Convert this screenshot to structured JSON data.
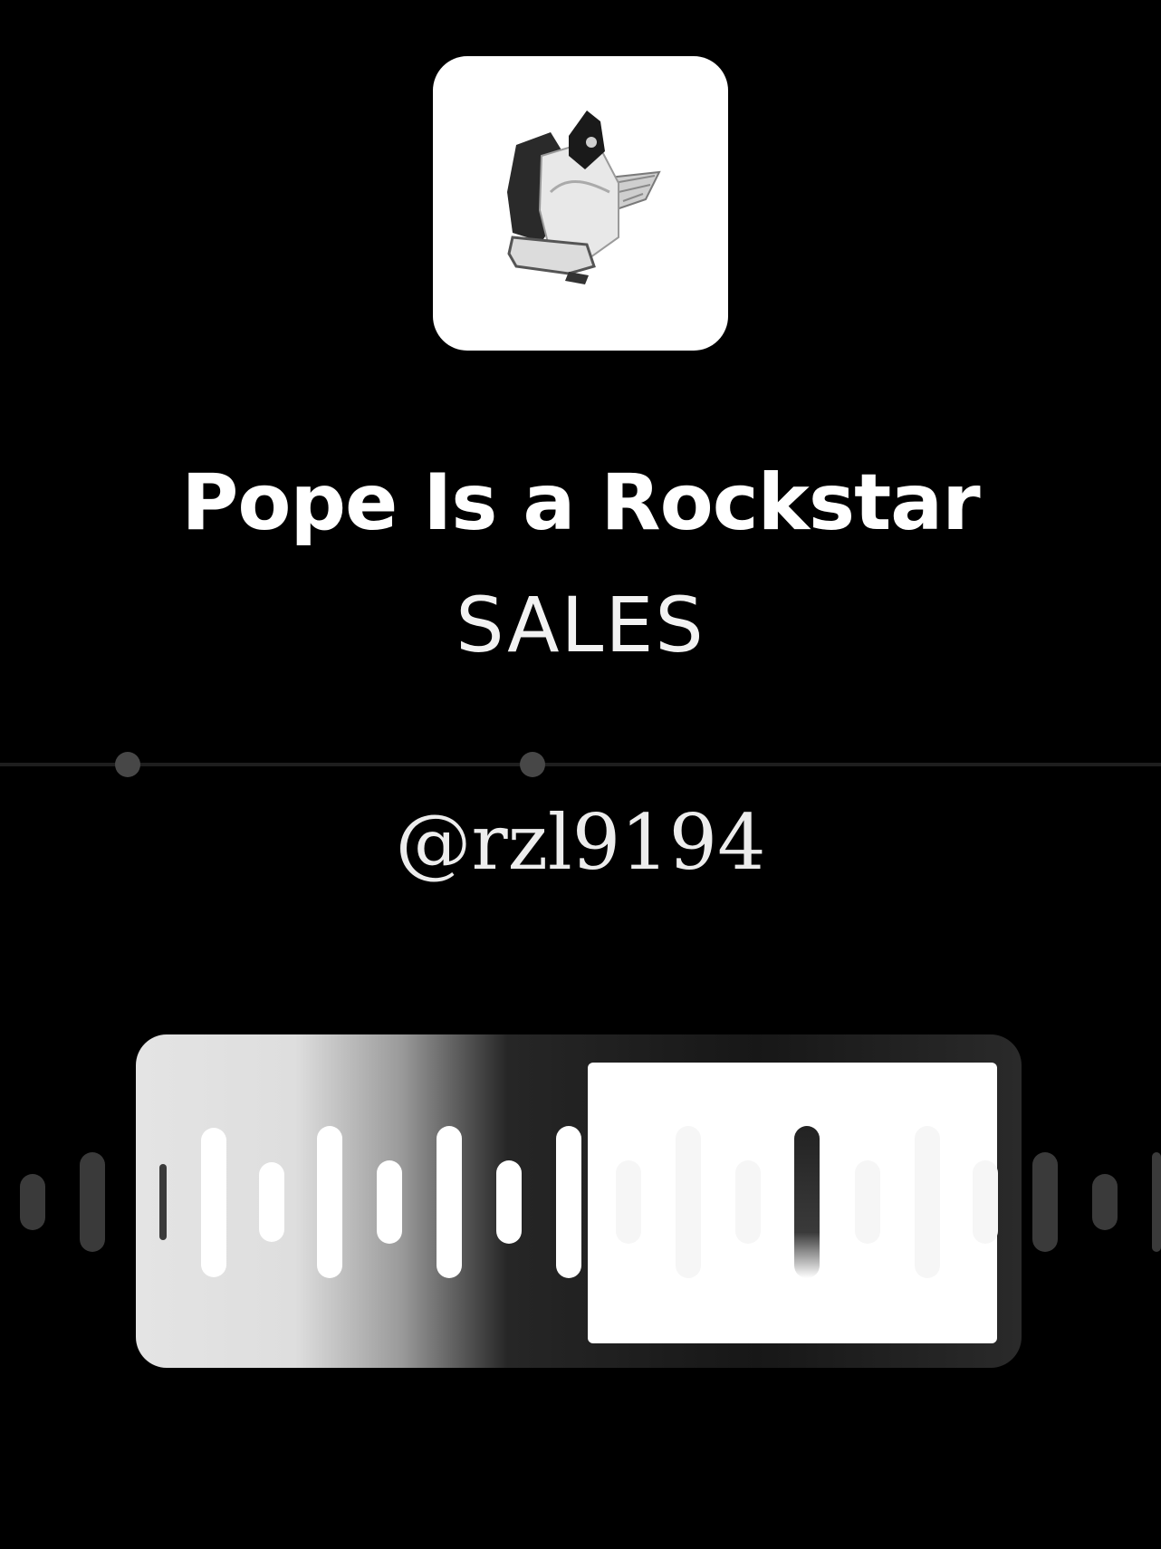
{
  "track": {
    "title": "Pope Is a Rockstar",
    "artist": "SALES",
    "handle": "@rzl9194"
  },
  "cover_art": {
    "description_icon": "album-cover-collage-icon",
    "background_color": "#ffffff"
  },
  "progress": {
    "fraction": 0.42
  },
  "colors": {
    "background": "#000000",
    "text": "#ffffff",
    "waveform_played": "#ffffff",
    "waveform_outside": "#3a3a3a"
  }
}
